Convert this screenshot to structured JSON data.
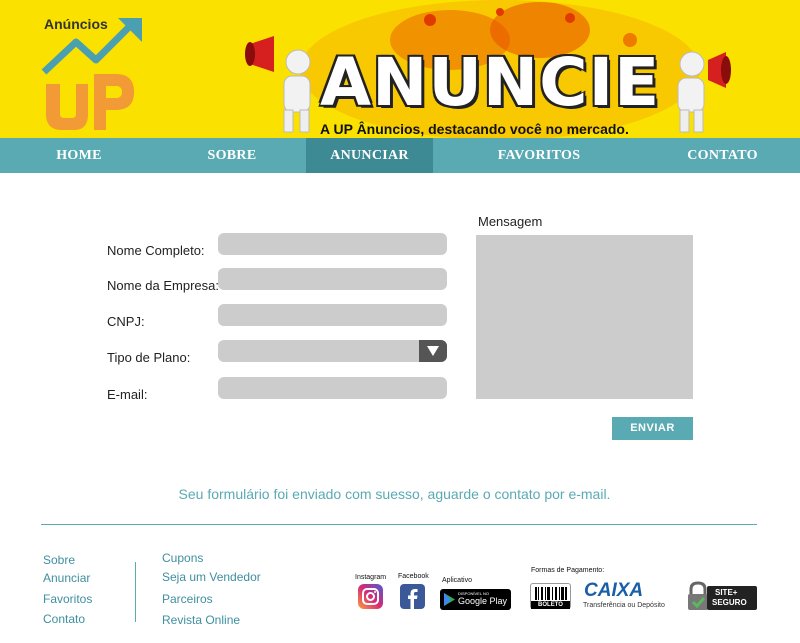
{
  "header": {
    "logo_text": "Anúncios",
    "banner_title": "ANUNCIE",
    "banner_subtitle": "A UP Ânuncios, destacando você no mercado."
  },
  "nav": {
    "items": [
      {
        "label": "HOME"
      },
      {
        "label": "SOBRE"
      },
      {
        "label": "ANUNCIAR"
      },
      {
        "label": "FAVORITOS"
      },
      {
        "label": "CONTATO"
      }
    ],
    "active": "ANUNCIAR"
  },
  "form": {
    "full_name_label": "Nome Completo:",
    "company_label": "Nome da Empresa:",
    "cnpj_label": "CNPJ:",
    "plan_label": "Tipo de Plano:",
    "email_label": "E-mail:",
    "message_label": "Mensagem",
    "send_label": "ENVIAR",
    "success_message": "Seu formulário foi enviado com suesso, aguarde o contato por e-mail."
  },
  "footer": {
    "col1": [
      "Sobre",
      "Anunciar",
      "Favoritos",
      "Contato"
    ],
    "col2": [
      "Cupons",
      "Seja um Vendedor",
      "Parceiros",
      "Revista Online"
    ],
    "instagram_label": "Instagram",
    "facebook_label": "Facebook",
    "app_label": "Aplicativo",
    "gplay_small": "DISPONÍVEL NO",
    "gplay_label": "Google Play",
    "payment_label": "Formas de Pagamento:",
    "boleto_label": "BOLETO",
    "caixa_label": "CAIXA",
    "caixa_sub": "Transferência ou Depósito",
    "secure_label1": "SITE+",
    "secure_label2": "SEGURO"
  },
  "colors": {
    "brand_yellow": "#fbe100",
    "teal": "#5aaab4",
    "teal_dark": "#3e8a94",
    "field_gray": "#cccccc"
  }
}
